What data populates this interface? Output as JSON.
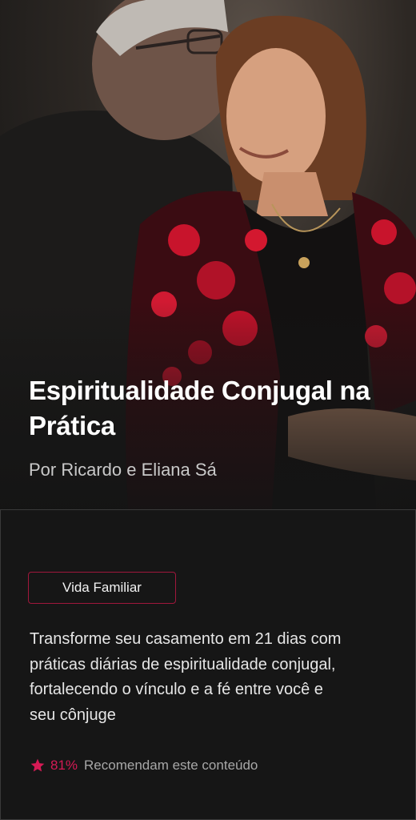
{
  "course": {
    "title": "Espiritualidade Conjugal na Prática",
    "author": "Por Ricardo e Eliana Sá",
    "category": "Vida Familiar",
    "description": "Transforme seu casamento em 21 dias com práticas diárias de espiritualidade conjugal, fortalecendo o vínculo e a fé entre você e seu cônjuge",
    "recommend_percent": "81%",
    "recommend_text": "Recomendam este conteúdo"
  },
  "icons": {
    "rating": "star-icon"
  },
  "colors": {
    "accent": "#d61a55",
    "tag_border": "#a0173c",
    "background": "#141414",
    "panel_border": "#3a3a3a"
  }
}
